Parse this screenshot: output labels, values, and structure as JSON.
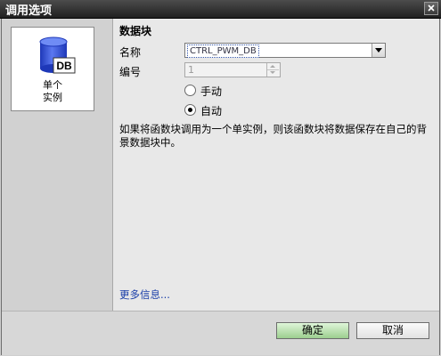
{
  "window": {
    "title": "调用选项"
  },
  "left_panel": {
    "tile_label": "单个\n实例",
    "icon_text": "DB",
    "icon_color": "#2d4fd4"
  },
  "data_block": {
    "section_title": "数据块",
    "name_label": "名称",
    "name_value": "CTRL_PWM_DB",
    "number_label": "编号",
    "number_value": "1",
    "radio_manual": "手动",
    "radio_auto": "自动",
    "selected": "自动",
    "description": "如果将函数块调用为一个单实例，则该函数块将数据保存在自己的背景数据块中。",
    "more_info": "更多信息..."
  },
  "buttons": {
    "ok": "确定",
    "cancel": "取消"
  }
}
